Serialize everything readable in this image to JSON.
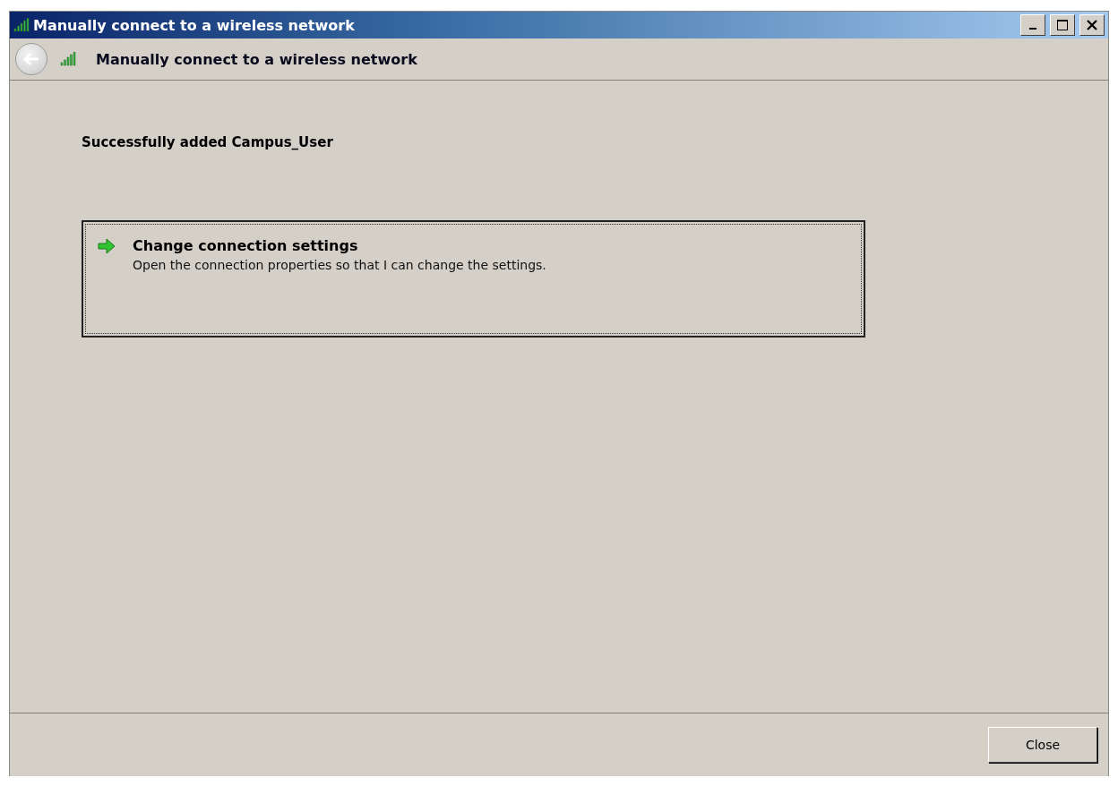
{
  "window": {
    "title": "Manually connect to a wireless network"
  },
  "header": {
    "title": "Manually connect to a wireless network"
  },
  "message": "Successfully added Campus_User",
  "command_link": {
    "title": "Change connection settings",
    "description": "Open the connection properties so that I can change the settings.",
    "focused": true
  },
  "buttons": [
    "Close"
  ]
}
